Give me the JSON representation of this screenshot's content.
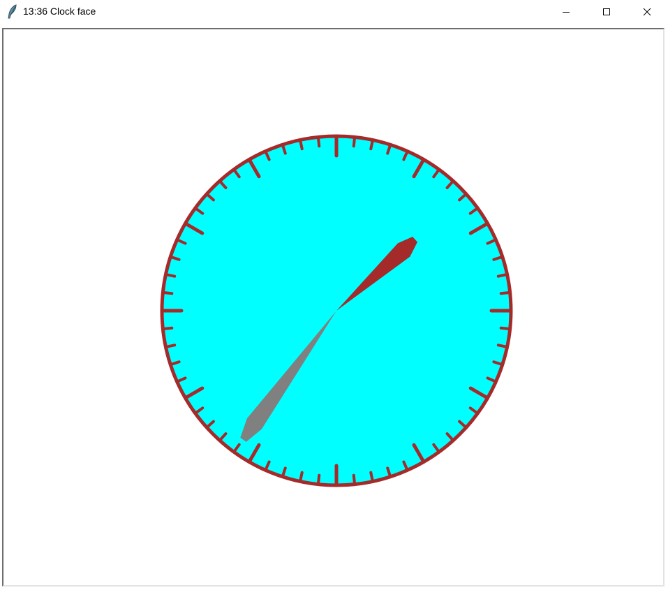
{
  "window": {
    "title": "13:36 Clock face",
    "icon": "feather-icon"
  },
  "title_buttons": {
    "minimize_icon": "minimize-icon",
    "maximize_icon": "maximize-icon",
    "close_icon": "close-icon"
  },
  "clock": {
    "time": "13:36",
    "hours": 13,
    "minutes": 36,
    "face_color": "#00ffff",
    "rim_color": "#a52a2a",
    "tick_color": "#a52a2a",
    "hour_hand_color": "#a52a2a",
    "minute_hand_color": "#808080",
    "background_color": "#ffffff"
  }
}
